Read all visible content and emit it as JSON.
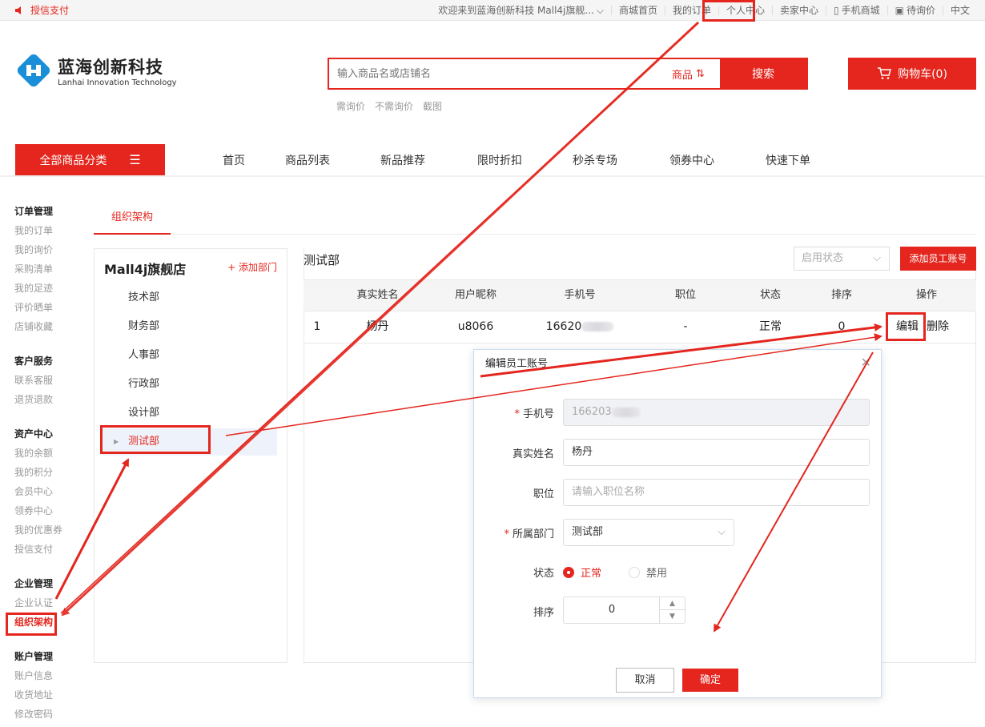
{
  "topbar": {
    "left_label": "授信支付",
    "links": [
      "欢迎来到蓝海创新科技 Mall4j旗舰...",
      "商城首页",
      "我的订单",
      "个人中心",
      "卖家中心",
      "手机商城",
      "待询价",
      "中文"
    ]
  },
  "brand": {
    "name": "蓝海创新科技",
    "en": "Lanhai Innovation Technology"
  },
  "search": {
    "placeholder": "输入商品名或店铺名",
    "category": "商品",
    "button": "搜索",
    "hotwords": [
      "需询价",
      "不需询价",
      "截图"
    ]
  },
  "cart": {
    "label": "购物车(0)"
  },
  "nav": {
    "all_categories": "全部商品分类",
    "links": [
      "首页",
      "商品列表",
      "新品推荐",
      "限时折扣",
      "秒杀专场",
      "领券中心",
      "快速下单"
    ]
  },
  "sidebar": {
    "groups": [
      {
        "title": "订单管理",
        "items": [
          "我的订单",
          "我的询价",
          "采购清单",
          "我的足迹",
          "评价晒单",
          "店铺收藏"
        ]
      },
      {
        "title": "客户服务",
        "items": [
          "联系客服",
          "退货退款"
        ]
      },
      {
        "title": "资产中心",
        "items": [
          "我的余额",
          "我的积分",
          "会员中心",
          "领券中心",
          "我的优惠券",
          "授信支付"
        ]
      },
      {
        "title": "企业管理",
        "items": [
          "企业认证",
          "组织架构"
        ]
      },
      {
        "title": "账户管理",
        "items": [
          "账户信息",
          "收货地址",
          "修改密码"
        ]
      }
    ],
    "active": "组织架构"
  },
  "main": {
    "tab": "组织架构",
    "shop_name": "Mall4j旗舰店",
    "add_dept": "+ 添加部门",
    "departments": [
      "技术部",
      "财务部",
      "人事部",
      "行政部",
      "设计部",
      "测试部"
    ],
    "selected_dept": "测试部",
    "dept_title": "测试部",
    "status_select_placeholder": "启用状态",
    "add_staff": "添加员工账号",
    "columns": [
      "真实姓名",
      "用户昵称",
      "手机号",
      "职位",
      "状态",
      "排序",
      "操作"
    ],
    "rows": [
      {
        "index": "1",
        "name": "杨丹",
        "nickname": "u8066",
        "phone": "16620",
        "position": "-",
        "status": "正常",
        "sort": "0",
        "edit": "编辑",
        "delete": "删除"
      }
    ]
  },
  "dialog": {
    "title": "编辑员工账号",
    "fields": {
      "phone_label": "手机号",
      "phone_value": "166203",
      "name_label": "真实姓名",
      "name_value": "杨丹",
      "position_label": "职位",
      "position_placeholder": "请输入职位名称",
      "dept_label": "所属部门",
      "dept_value": "测试部",
      "status_label": "状态",
      "status_on": "正常",
      "status_off": "禁用",
      "sort_label": "排序",
      "sort_value": "0"
    },
    "cancel": "取消",
    "ok": "确定"
  },
  "colors": {
    "accent": "#e4261e",
    "brand_blue": "#1a8fd8"
  }
}
